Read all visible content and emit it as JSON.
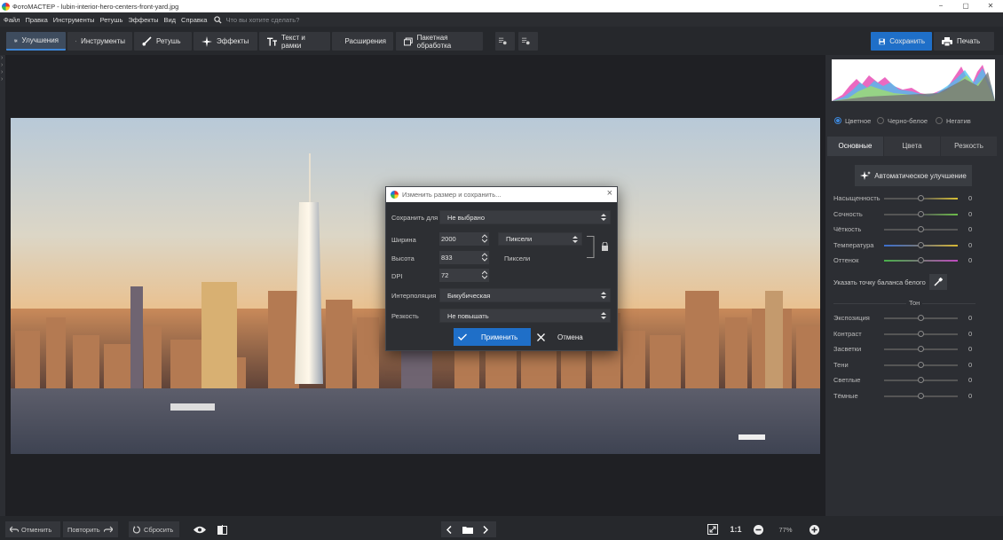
{
  "window": {
    "title": "ФотоМАСТЕР - lubin-interior-hero-centers-front-yard.jpg",
    "minimize": "−",
    "maximize": "▢",
    "close": "✕"
  },
  "menu": {
    "items": [
      "Файл",
      "Правка",
      "Инструменты",
      "Ретушь",
      "Эффекты",
      "Вид",
      "Справка"
    ],
    "search_placeholder": "Что вы хотите сделать?"
  },
  "toolbar": {
    "tabs": [
      {
        "label": "Улучшения",
        "icon": "sliders-icon",
        "active": true
      },
      {
        "label": "Инструменты",
        "icon": "crop-icon",
        "active": false
      },
      {
        "label": "Ретушь",
        "icon": "brush-icon",
        "active": false
      },
      {
        "label": "Эффекты",
        "icon": "sparkle-icon",
        "active": false
      },
      {
        "label": "Текст и рамки",
        "icon": "text-icon",
        "active": false
      },
      {
        "label": "Расширения",
        "icon": "plus-icon",
        "active": false
      },
      {
        "label": "Пакетная обработка",
        "icon": "batch-icon",
        "active": false
      }
    ],
    "save_label": "Сохранить",
    "print_label": "Печать"
  },
  "right_panel": {
    "modes": [
      {
        "label": "Цветное",
        "selected": true
      },
      {
        "label": "Черно-белое",
        "selected": false
      },
      {
        "label": "Негатив",
        "selected": false
      }
    ],
    "tabs": [
      "Основные",
      "Цвета",
      "Резкость"
    ],
    "auto_button": "Автоматическое улучшение",
    "sliders_main": [
      {
        "label": "Насыщенность",
        "value": "0",
        "level": 0.5
      },
      {
        "label": "Сочность",
        "value": "0",
        "level": 0.5
      },
      {
        "label": "Чёткость",
        "value": "0",
        "level": 0.5
      },
      {
        "label": "Температура",
        "value": "0",
        "level": 0.5
      },
      {
        "label": "Оттенок",
        "value": "0",
        "level": 0.5
      }
    ],
    "white_balance_label": "Указать точку баланса белого",
    "tone_heading": "Тон",
    "sliders_tone": [
      {
        "label": "Экспозиция",
        "value": "0",
        "level": 0.5
      },
      {
        "label": "Контраст",
        "value": "0",
        "level": 0.5
      },
      {
        "label": "Засветки",
        "value": "0",
        "level": 0.5
      },
      {
        "label": "Тени",
        "value": "0",
        "level": 0.5
      },
      {
        "label": "Светлые",
        "value": "0",
        "level": 0.5
      },
      {
        "label": "Тёмные",
        "value": "0",
        "level": 0.5
      }
    ]
  },
  "dialog": {
    "title": "Изменить размер и сохранить...",
    "save_for_label": "Сохранить для",
    "save_for_value": "Не выбрано",
    "width_label": "Ширина",
    "width_value": "2000",
    "unit_value": "Пиксели",
    "height_label": "Высота",
    "height_value": "833",
    "height_unit": "Пиксели",
    "dpi_label": "DPI",
    "dpi_value": "72",
    "interp_label": "Интерполяция",
    "interp_value": "Бикубическая",
    "sharp_label": "Резкость",
    "sharp_value": "Не повышать",
    "apply_label": "Применить",
    "cancel_label": "Отмена"
  },
  "bottom": {
    "undo_label": "Отменить",
    "redo_label": "Повторить",
    "reset_label": "Сбросить",
    "ratio_label": "1:1",
    "zoom_value": "77%"
  }
}
